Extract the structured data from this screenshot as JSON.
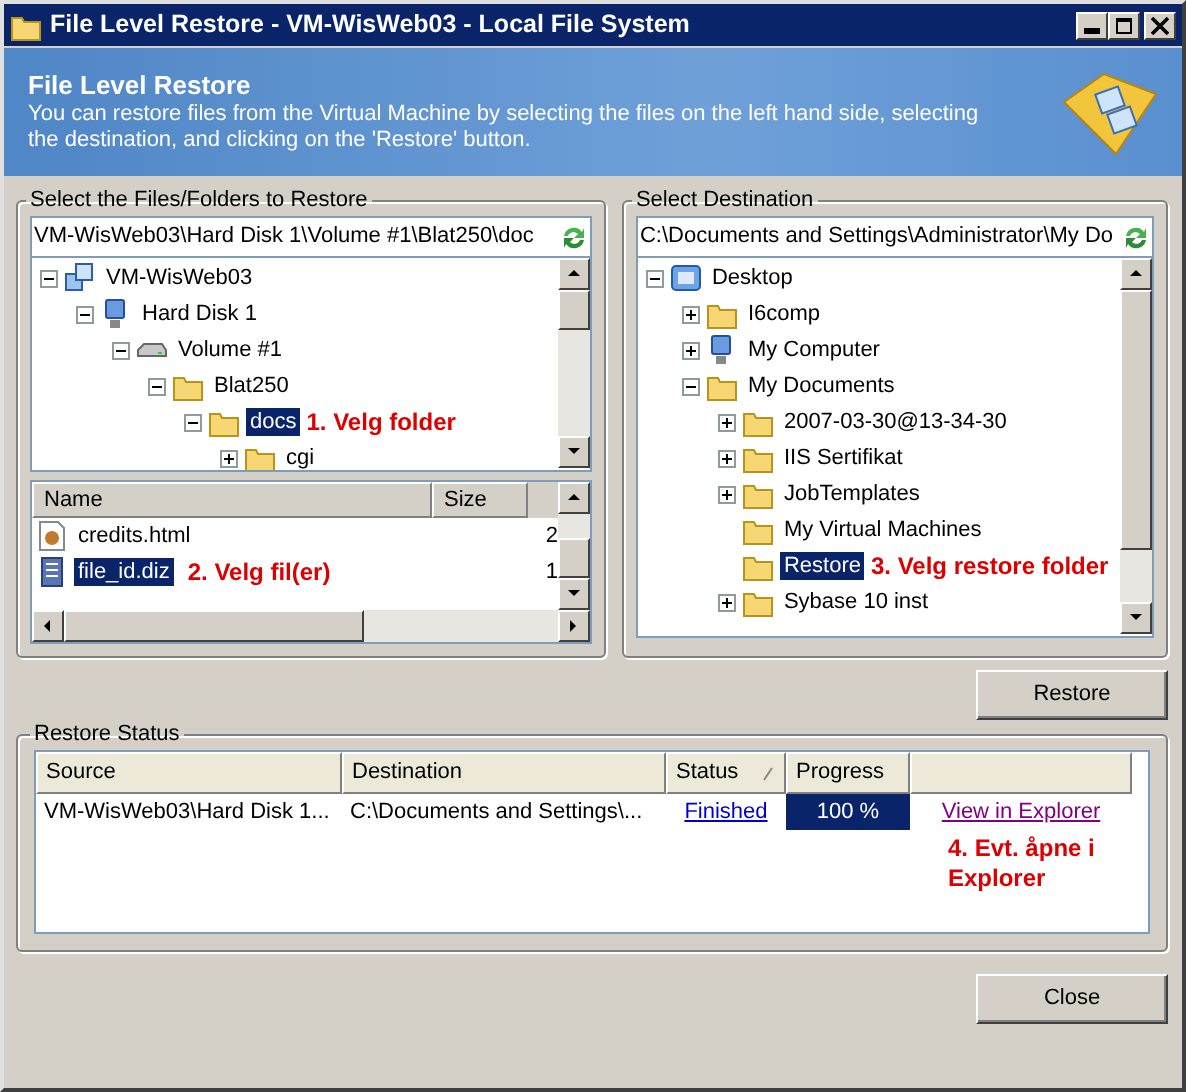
{
  "window": {
    "title": "File Level Restore - VM-WisWeb03 - Local File System"
  },
  "banner": {
    "title": "File Level Restore",
    "description": "You can restore files from the Virtual Machine by selecting the files on the left hand side, selecting the destination, and clicking on the 'Restore' button."
  },
  "source": {
    "label": "Select the Files/Folders to Restore",
    "path": "VM-WisWeb03\\Hard Disk 1\\Volume #1\\Blat250\\doc",
    "tree": [
      {
        "label": "VM-WisWeb03",
        "kind": "vm",
        "expanded": true,
        "selected": false,
        "children": [
          {
            "label": "Hard Disk 1",
            "kind": "disk",
            "expanded": true,
            "selected": false,
            "children": [
              {
                "label": "Volume #1",
                "kind": "drive",
                "expanded": true,
                "selected": false,
                "children": [
                  {
                    "label": "Blat250",
                    "kind": "folder",
                    "expanded": true,
                    "selected": false,
                    "children": [
                      {
                        "label": "docs",
                        "kind": "folder",
                        "expanded": true,
                        "selected": true,
                        "note": "1. Velg folder",
                        "children": [
                          {
                            "label": "cgi",
                            "kind": "folder",
                            "expanded": false,
                            "selected": false
                          }
                        ]
                      }
                    ]
                  }
                ]
              }
            ]
          }
        ]
      }
    ],
    "files": {
      "columns": [
        "Name",
        "Size"
      ],
      "rows": [
        {
          "name": "credits.html",
          "size": "2",
          "kind": "html",
          "selected": false
        },
        {
          "name": "file_id.diz",
          "size": "1",
          "kind": "text",
          "selected": true,
          "note": "2. Velg fil(er)"
        }
      ]
    }
  },
  "destination": {
    "label": "Select Destination",
    "path": "C:\\Documents and Settings\\Administrator\\My Do",
    "tree": [
      {
        "label": "Desktop",
        "kind": "desktop",
        "expanded": true,
        "selected": false,
        "children": [
          {
            "label": "I6comp",
            "kind": "folder",
            "expanded": false,
            "selected": false
          },
          {
            "label": "My Computer",
            "kind": "computer",
            "expanded": false,
            "selected": false
          },
          {
            "label": "My Documents",
            "kind": "folder",
            "expanded": true,
            "selected": false,
            "children": [
              {
                "label": "2007-03-30@13-34-30",
                "kind": "folder",
                "expanded": false,
                "selected": false
              },
              {
                "label": "IIS Sertifikat",
                "kind": "folder",
                "expanded": false,
                "selected": false
              },
              {
                "label": "JobTemplates",
                "kind": "folder",
                "expanded": false,
                "selected": false
              },
              {
                "label": "My Virtual Machines",
                "kind": "folder",
                "selected": false
              },
              {
                "label": "Restore",
                "kind": "folder",
                "selected": true,
                "note": "3. Velg restore folder"
              },
              {
                "label": "Sybase 10 inst",
                "kind": "folder",
                "expanded": false,
                "selected": false
              }
            ]
          }
        ]
      }
    ]
  },
  "restore_button": "Restore",
  "status": {
    "label": "Restore Status",
    "columns": [
      "Source",
      "Destination",
      "Status",
      "Progress",
      ""
    ],
    "rows": [
      {
        "source": "VM-WisWeb03\\Hard Disk 1...",
        "destination": "C:\\Documents and Settings\\...",
        "status": "Finished",
        "progress": "100 %",
        "level": 1,
        "link": "View in Explorer"
      }
    ],
    "note": "4. Evt. åpne i Explorer"
  },
  "close_button": "Close"
}
